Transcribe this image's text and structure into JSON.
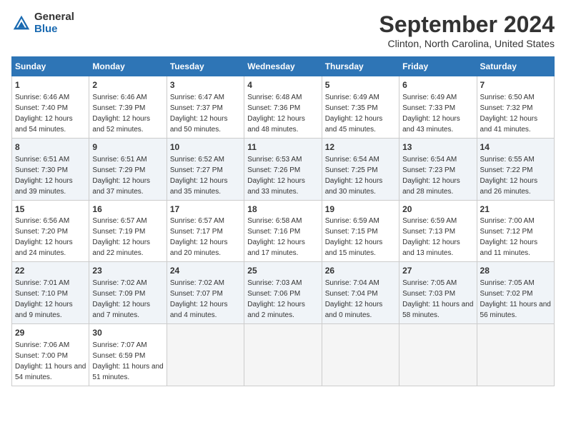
{
  "header": {
    "logo_general": "General",
    "logo_blue": "Blue",
    "title": "September 2024",
    "location": "Clinton, North Carolina, United States"
  },
  "weekdays": [
    "Sunday",
    "Monday",
    "Tuesday",
    "Wednesday",
    "Thursday",
    "Friday",
    "Saturday"
  ],
  "weeks": [
    [
      {
        "num": "1",
        "sunrise": "6:46 AM",
        "sunset": "7:40 PM",
        "daylight": "12 hours and 54 minutes."
      },
      {
        "num": "2",
        "sunrise": "6:46 AM",
        "sunset": "7:39 PM",
        "daylight": "12 hours and 52 minutes."
      },
      {
        "num": "3",
        "sunrise": "6:47 AM",
        "sunset": "7:37 PM",
        "daylight": "12 hours and 50 minutes."
      },
      {
        "num": "4",
        "sunrise": "6:48 AM",
        "sunset": "7:36 PM",
        "daylight": "12 hours and 48 minutes."
      },
      {
        "num": "5",
        "sunrise": "6:49 AM",
        "sunset": "7:35 PM",
        "daylight": "12 hours and 45 minutes."
      },
      {
        "num": "6",
        "sunrise": "6:49 AM",
        "sunset": "7:33 PM",
        "daylight": "12 hours and 43 minutes."
      },
      {
        "num": "7",
        "sunrise": "6:50 AM",
        "sunset": "7:32 PM",
        "daylight": "12 hours and 41 minutes."
      }
    ],
    [
      {
        "num": "8",
        "sunrise": "6:51 AM",
        "sunset": "7:30 PM",
        "daylight": "12 hours and 39 minutes."
      },
      {
        "num": "9",
        "sunrise": "6:51 AM",
        "sunset": "7:29 PM",
        "daylight": "12 hours and 37 minutes."
      },
      {
        "num": "10",
        "sunrise": "6:52 AM",
        "sunset": "7:27 PM",
        "daylight": "12 hours and 35 minutes."
      },
      {
        "num": "11",
        "sunrise": "6:53 AM",
        "sunset": "7:26 PM",
        "daylight": "12 hours and 33 minutes."
      },
      {
        "num": "12",
        "sunrise": "6:54 AM",
        "sunset": "7:25 PM",
        "daylight": "12 hours and 30 minutes."
      },
      {
        "num": "13",
        "sunrise": "6:54 AM",
        "sunset": "7:23 PM",
        "daylight": "12 hours and 28 minutes."
      },
      {
        "num": "14",
        "sunrise": "6:55 AM",
        "sunset": "7:22 PM",
        "daylight": "12 hours and 26 minutes."
      }
    ],
    [
      {
        "num": "15",
        "sunrise": "6:56 AM",
        "sunset": "7:20 PM",
        "daylight": "12 hours and 24 minutes."
      },
      {
        "num": "16",
        "sunrise": "6:57 AM",
        "sunset": "7:19 PM",
        "daylight": "12 hours and 22 minutes."
      },
      {
        "num": "17",
        "sunrise": "6:57 AM",
        "sunset": "7:17 PM",
        "daylight": "12 hours and 20 minutes."
      },
      {
        "num": "18",
        "sunrise": "6:58 AM",
        "sunset": "7:16 PM",
        "daylight": "12 hours and 17 minutes."
      },
      {
        "num": "19",
        "sunrise": "6:59 AM",
        "sunset": "7:15 PM",
        "daylight": "12 hours and 15 minutes."
      },
      {
        "num": "20",
        "sunrise": "6:59 AM",
        "sunset": "7:13 PM",
        "daylight": "12 hours and 13 minutes."
      },
      {
        "num": "21",
        "sunrise": "7:00 AM",
        "sunset": "7:12 PM",
        "daylight": "12 hours and 11 minutes."
      }
    ],
    [
      {
        "num": "22",
        "sunrise": "7:01 AM",
        "sunset": "7:10 PM",
        "daylight": "12 hours and 9 minutes."
      },
      {
        "num": "23",
        "sunrise": "7:02 AM",
        "sunset": "7:09 PM",
        "daylight": "12 hours and 7 minutes."
      },
      {
        "num": "24",
        "sunrise": "7:02 AM",
        "sunset": "7:07 PM",
        "daylight": "12 hours and 4 minutes."
      },
      {
        "num": "25",
        "sunrise": "7:03 AM",
        "sunset": "7:06 PM",
        "daylight": "12 hours and 2 minutes."
      },
      {
        "num": "26",
        "sunrise": "7:04 AM",
        "sunset": "7:04 PM",
        "daylight": "12 hours and 0 minutes."
      },
      {
        "num": "27",
        "sunrise": "7:05 AM",
        "sunset": "7:03 PM",
        "daylight": "11 hours and 58 minutes."
      },
      {
        "num": "28",
        "sunrise": "7:05 AM",
        "sunset": "7:02 PM",
        "daylight": "11 hours and 56 minutes."
      }
    ],
    [
      {
        "num": "29",
        "sunrise": "7:06 AM",
        "sunset": "7:00 PM",
        "daylight": "11 hours and 54 minutes."
      },
      {
        "num": "30",
        "sunrise": "7:07 AM",
        "sunset": "6:59 PM",
        "daylight": "11 hours and 51 minutes."
      },
      null,
      null,
      null,
      null,
      null
    ]
  ]
}
